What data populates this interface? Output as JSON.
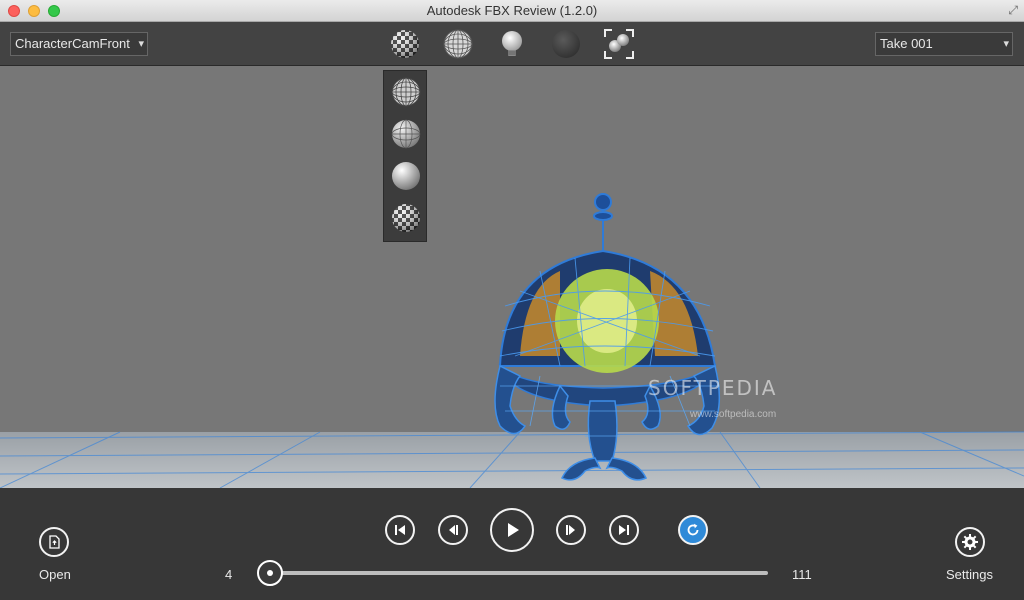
{
  "window": {
    "title": "Autodesk FBX Review (1.2.0)"
  },
  "toolbar": {
    "camera_select": "CharacterCamFront",
    "take_select": "Take 001",
    "buttons": [
      "textured-shading-icon",
      "wireframe-shading-icon",
      "lighting-icon",
      "dark-sphere-icon",
      "frame-all-icon"
    ]
  },
  "shading_menu": {
    "items": [
      "wireframe-sphere-icon",
      "flat-shaded-wire-icon",
      "smooth-shaded-sphere-icon",
      "textured-checker-icon"
    ]
  },
  "watermark": {
    "brand": "SOFTPEDIA",
    "url": "www.softpedia.com"
  },
  "playback": {
    "open_label": "Open",
    "settings_label": "Settings",
    "start_frame": "4",
    "end_frame": "111",
    "position_fraction": 0.0
  },
  "colors": {
    "accent": "#2f8ad8",
    "toolbar_bg": "#434343",
    "viewport_bg": "#777777",
    "wire": "#2f7bd8"
  }
}
